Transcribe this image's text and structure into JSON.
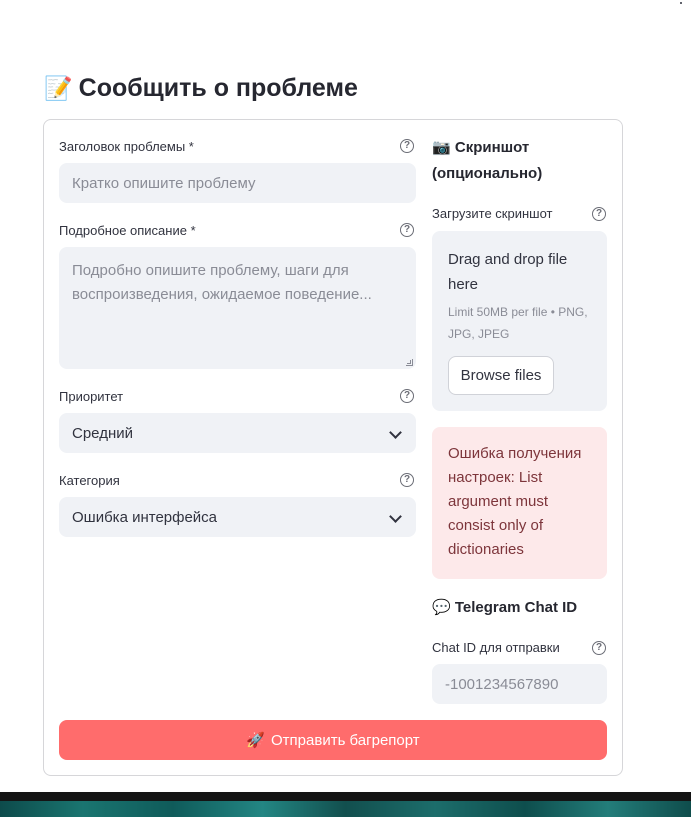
{
  "page": {
    "title": "Сообщить о проблеме",
    "title_icon": "memo-icon"
  },
  "form": {
    "issue_title": {
      "label": "Заголовок проблемы *",
      "placeholder": "Кратко опишите проблему"
    },
    "description": {
      "label": "Подробное описание *",
      "placeholder": "Подробно опишите проблему, шаги для воспроизведения, ожидаемое поведение..."
    },
    "priority": {
      "label": "Приоритет",
      "value": "Средний"
    },
    "category": {
      "label": "Категория",
      "value": "Ошибка интерфейса"
    },
    "screenshot": {
      "heading": "Скриншот (опционально)",
      "heading_icon": "camera-icon",
      "label": "Загрузите скриншот",
      "drop_text": "Drag and drop file here",
      "limit_text": "Limit 50MB per file • PNG, JPG, JPEG",
      "browse_label": "Browse files"
    },
    "error_message": "Ошибка получения настроек: List argument must consist only of dictionaries",
    "telegram": {
      "heading": "Telegram Chat ID",
      "heading_icon": "speech-bubble-icon",
      "label": "Chat ID для отправки",
      "placeholder": "-1001234567890"
    },
    "submit_label": "Отправить багрепорт",
    "submit_icon": "rocket-icon",
    "help_glyph": "?"
  },
  "colors": {
    "primary": "#ff6c6c",
    "error_bg": "#fde9ea",
    "error_text": "#7d353b",
    "input_bg": "#f0f2f6"
  }
}
